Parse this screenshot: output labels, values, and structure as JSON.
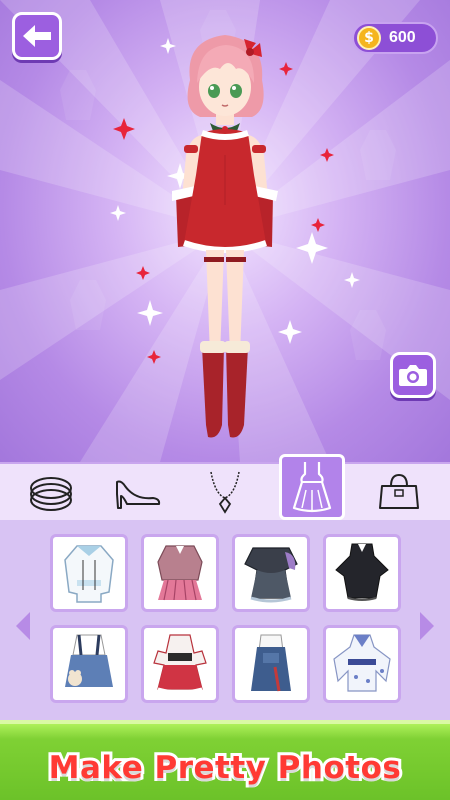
{
  "header": {
    "back_button_icon": "back-arrow-icon",
    "coin_symbol": "$",
    "coin_count": "600"
  },
  "stage": {
    "camera_icon": "camera-icon",
    "character": "dressed-up-character",
    "outfit_color": "#c8282d",
    "hair_color": "#f2aab4"
  },
  "categories": [
    {
      "icon": "bracelet-icon",
      "active": false
    },
    {
      "icon": "high-heel-shoe-icon",
      "active": false
    },
    {
      "icon": "necklace-icon",
      "active": false
    },
    {
      "icon": "dress-icon",
      "active": true
    },
    {
      "icon": "handbag-icon",
      "active": false
    }
  ],
  "items": [
    {
      "name": "white-blue-hoodie-outfit"
    },
    {
      "name": "pink-plaid-school-outfit"
    },
    {
      "name": "gothic-ruffle-dress"
    },
    {
      "name": "black-wing-dress"
    },
    {
      "name": "denim-suspender-skirt-outfit"
    },
    {
      "name": "red-white-lolita-dress"
    },
    {
      "name": "denim-pinafore-outfit"
    },
    {
      "name": "blue-kimono-dress"
    }
  ],
  "banner": {
    "text": "Make Pretty Photos"
  },
  "colors": {
    "accent": "#9c5fe0",
    "banner_green": "#7fd134",
    "banner_text": "#ff3a34"
  }
}
